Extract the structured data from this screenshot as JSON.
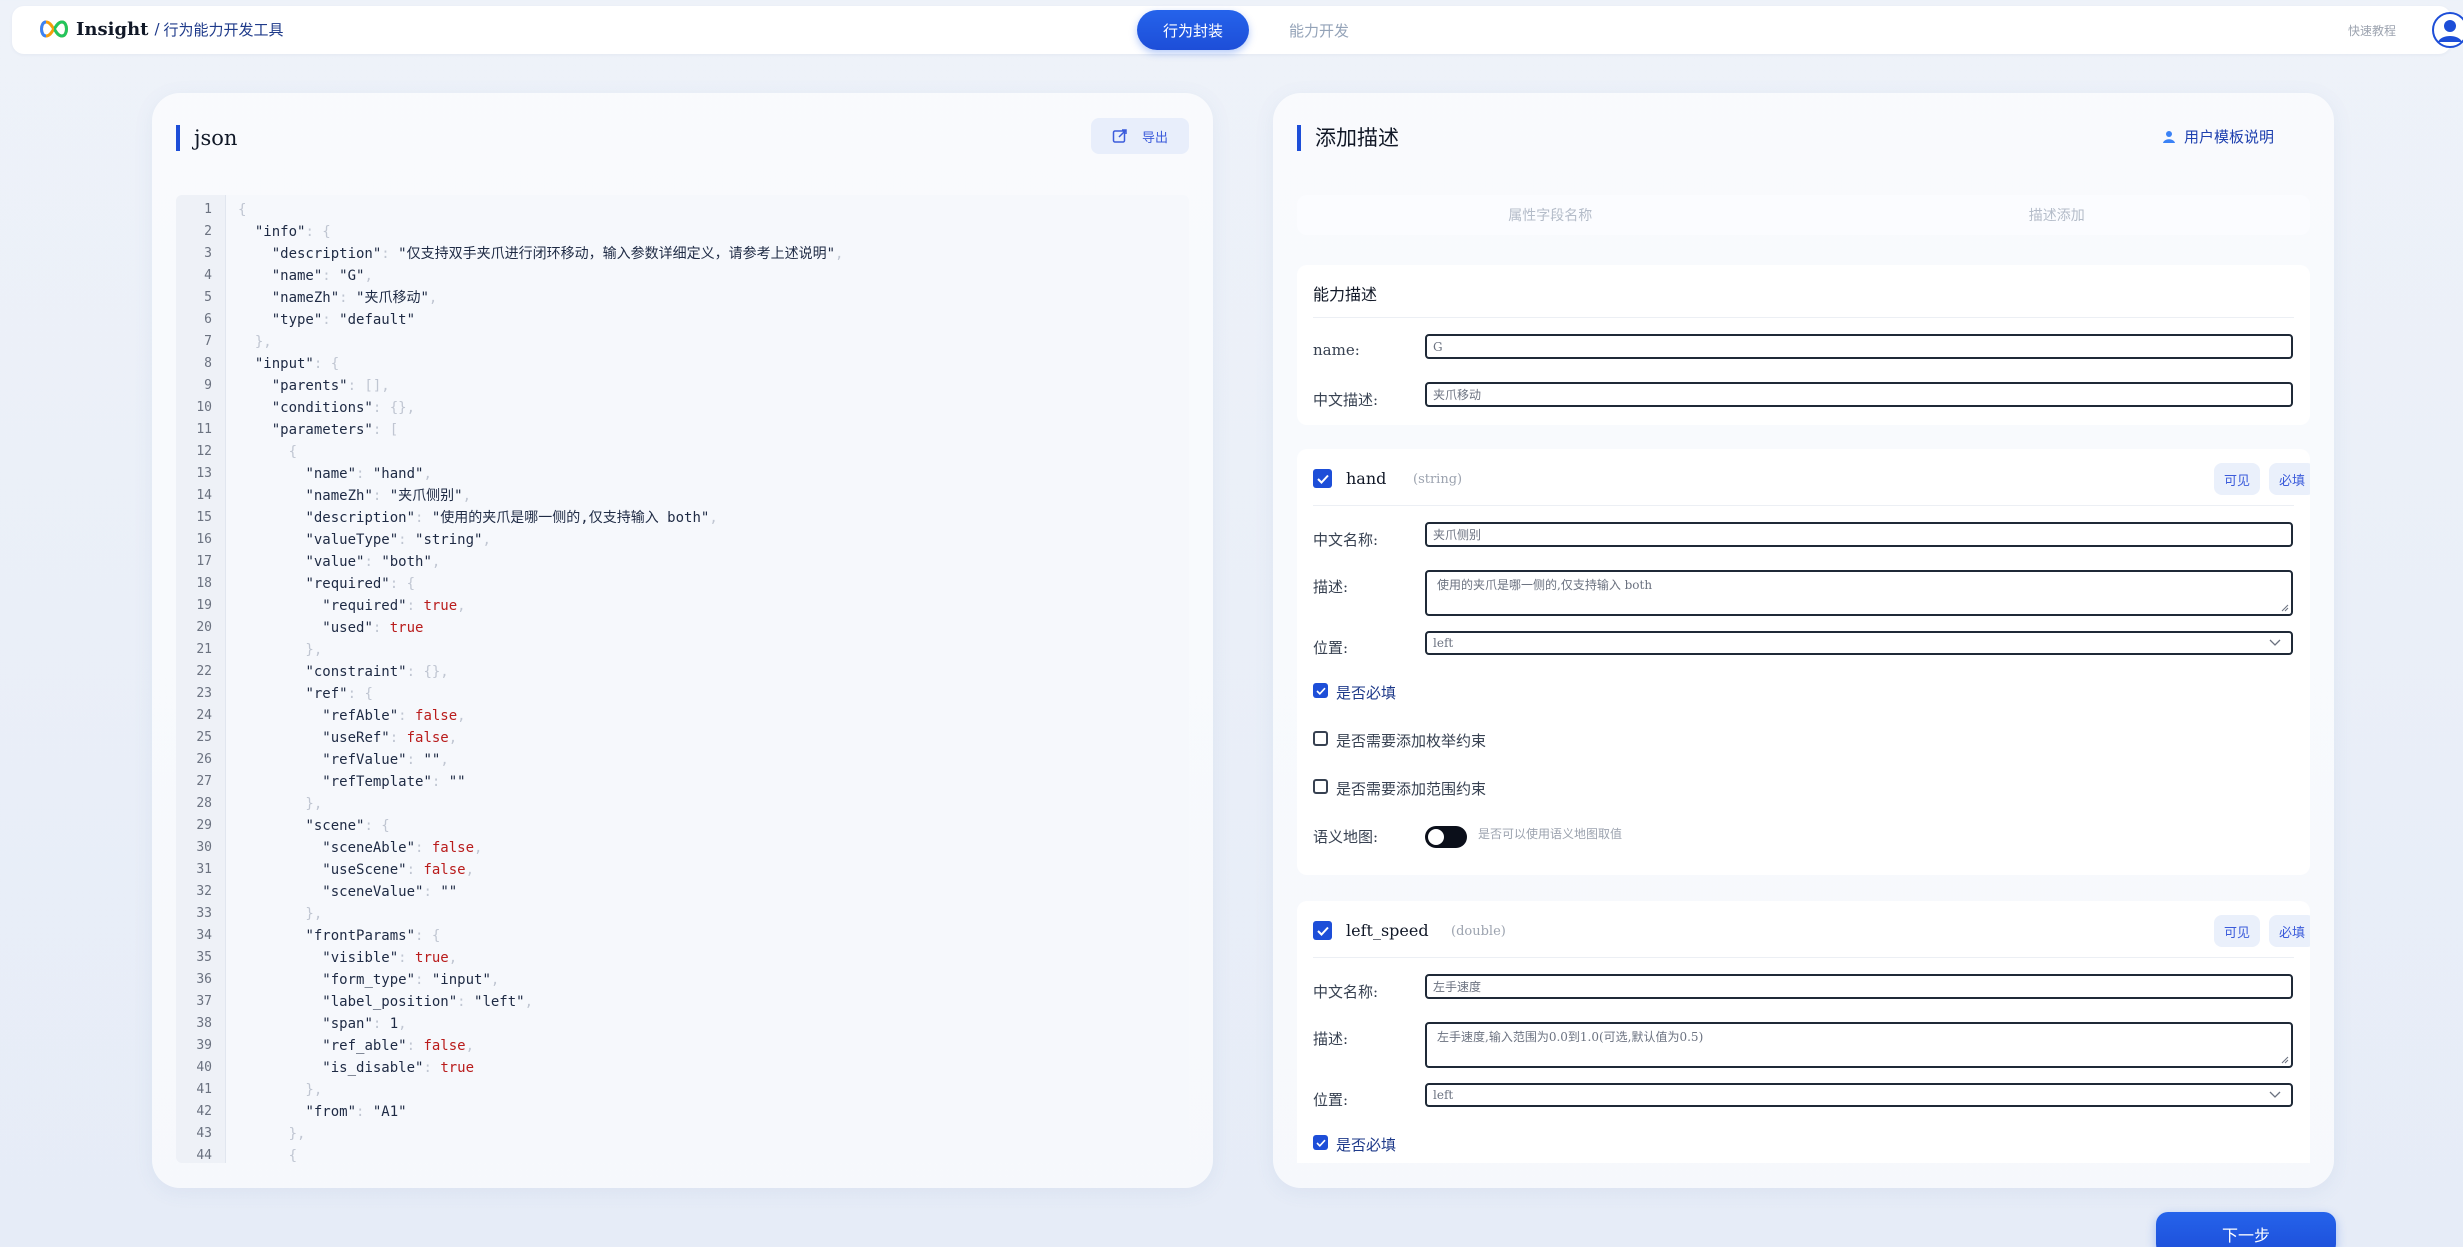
{
  "header": {
    "app_name": "Insight",
    "separator": "/",
    "subtitle": "行为能力开发工具",
    "tabs": [
      {
        "label": "行为封装",
        "active": true
      },
      {
        "label": "能力开发",
        "active": false
      }
    ],
    "quick_tutorial": "快速教程",
    "accent_color": "#1d4ed8"
  },
  "left_panel": {
    "title": "json",
    "export_label": "导出",
    "code_lines": [
      {
        "n": "1",
        "html": "{"
      },
      {
        "n": "2",
        "html": "  <span class=k>\"info\"</span>: {"
      },
      {
        "n": "3",
        "html": "    <span class=k>\"description\"</span>: <span class=s>\"仅支持双手夹爪进行闭环移动，输入参数详细定义，请参考上述说明\"</span>,"
      },
      {
        "n": "4",
        "html": "    <span class=k>\"name\"</span>: <span class=s>\"G\"</span>,"
      },
      {
        "n": "5",
        "html": "    <span class=k>\"nameZh\"</span>: <span class=s>\"夹爪移动\"</span>,"
      },
      {
        "n": "6",
        "html": "    <span class=k>\"type\"</span>: <span class=s>\"default\"</span>"
      },
      {
        "n": "7",
        "html": "  },"
      },
      {
        "n": "8",
        "html": "  <span class=k>\"input\"</span>: {"
      },
      {
        "n": "9",
        "html": "    <span class=k>\"parents\"</span>: [],"
      },
      {
        "n": "10",
        "html": "    <span class=k>\"conditions\"</span>: {},"
      },
      {
        "n": "11",
        "html": "    <span class=k>\"parameters\"</span>: ["
      },
      {
        "n": "12",
        "html": "      {"
      },
      {
        "n": "13",
        "html": "        <span class=k>\"name\"</span>: <span class=s>\"hand\"</span>,"
      },
      {
        "n": "14",
        "html": "        <span class=k>\"nameZh\"</span>: <span class=s>\"夹爪侧别\"</span>,"
      },
      {
        "n": "15",
        "html": "        <span class=k>\"description\"</span>: <span class=s>\"使用的夹爪是哪一侧的,仅支持输入 both\"</span>,"
      },
      {
        "n": "16",
        "html": "        <span class=k>\"valueType\"</span>: <span class=s>\"string\"</span>,"
      },
      {
        "n": "17",
        "html": "        <span class=k>\"value\"</span>: <span class=s>\"both\"</span>,"
      },
      {
        "n": "18",
        "html": "        <span class=k>\"required\"</span>: {"
      },
      {
        "n": "19",
        "html": "          <span class=k>\"required\"</span>: <span class=b>true</span>,"
      },
      {
        "n": "20",
        "html": "          <span class=k>\"used\"</span>: <span class=b>true</span>"
      },
      {
        "n": "21",
        "html": "        },"
      },
      {
        "n": "22",
        "html": "        <span class=k>\"constraint\"</span>: {},"
      },
      {
        "n": "23",
        "html": "        <span class=k>\"ref\"</span>: {"
      },
      {
        "n": "24",
        "html": "          <span class=k>\"refAble\"</span>: <span class=b>false</span>,"
      },
      {
        "n": "25",
        "html": "          <span class=k>\"useRef\"</span>: <span class=b>false</span>,"
      },
      {
        "n": "26",
        "html": "          <span class=k>\"refValue\"</span>: <span class=s>\"\"</span>,"
      },
      {
        "n": "27",
        "html": "          <span class=k>\"refTemplate\"</span>: <span class=s>\"\"</span>"
      },
      {
        "n": "28",
        "html": "        },"
      },
      {
        "n": "29",
        "html": "        <span class=k>\"scene\"</span>: {"
      },
      {
        "n": "30",
        "html": "          <span class=k>\"sceneAble\"</span>: <span class=b>false</span>,"
      },
      {
        "n": "31",
        "html": "          <span class=k>\"useScene\"</span>: <span class=b>false</span>,"
      },
      {
        "n": "32",
        "html": "          <span class=k>\"sceneValue\"</span>: <span class=s>\"\"</span>"
      },
      {
        "n": "33",
        "html": "        },"
      },
      {
        "n": "34",
        "html": "        <span class=k>\"frontParams\"</span>: {"
      },
      {
        "n": "35",
        "html": "          <span class=k>\"visible\"</span>: <span class=b>true</span>,"
      },
      {
        "n": "36",
        "html": "          <span class=k>\"form_type\"</span>: <span class=s>\"input\"</span>,"
      },
      {
        "n": "37",
        "html": "          <span class=k>\"label_position\"</span>: <span class=s>\"left\"</span>,"
      },
      {
        "n": "38",
        "html": "          <span class=k>\"span\"</span>: <span class=n>1</span>,"
      },
      {
        "n": "39",
        "html": "          <span class=k>\"ref_able\"</span>: <span class=b>false</span>,"
      },
      {
        "n": "40",
        "html": "          <span class=k>\"is_disable\"</span>: <span class=b>true</span>"
      },
      {
        "n": "41",
        "html": "        },"
      },
      {
        "n": "42",
        "html": "        <span class=k>\"from\"</span>: <span class=s>\"A1\"</span>"
      },
      {
        "n": "43",
        "html": "      },"
      },
      {
        "n": "44",
        "html": "      {"
      }
    ]
  },
  "right_panel": {
    "title": "添加描述",
    "user_template": "用户模板说明",
    "columns": [
      "属性字段名称",
      "描述添加"
    ],
    "ability": {
      "heading": "能力描述",
      "name_label": "name:",
      "name_value": "G",
      "zh_label": "中文描述:",
      "zh_value": "夹爪移动"
    },
    "params": [
      {
        "name": "hand",
        "type": "(string)",
        "visible_label": "可见",
        "required_label": "必填",
        "zh_name_label": "中文名称:",
        "zh_name_value": "夹爪侧别",
        "desc_label": "描述:",
        "desc_value": "使用的夹爪是哪一侧的,仅支持输入 both",
        "pos_label": "位置:",
        "pos_value": "left",
        "required_check": "是否必填",
        "enum_check": "是否需要添加枚举约束",
        "range_check": "是否需要添加范围约束",
        "semantic_label": "语义地图:",
        "semantic_hint": "是否可以使用语义地图取值"
      },
      {
        "name": "left_speed",
        "type": "(double)",
        "visible_label": "可见",
        "required_label": "必填",
        "zh_name_label": "中文名称:",
        "zh_name_value": "左手速度",
        "desc_label": "描述:",
        "desc_value": "左手速度,输入范围为0.0到1.0(可选,默认值为0.5)",
        "pos_label": "位置:",
        "pos_value": "left",
        "required_check": "是否必填"
      }
    ]
  },
  "footer": {
    "next_label": "下一步"
  }
}
